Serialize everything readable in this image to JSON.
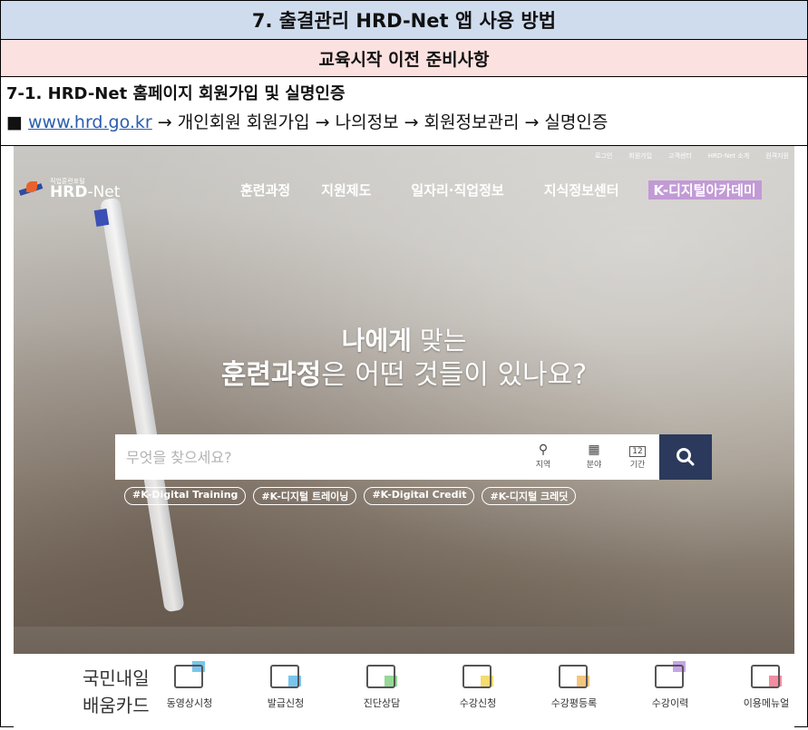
{
  "doc": {
    "title": "7. 출결관리 HRD-Net 앱 사용 방법",
    "section": "교육시작 이전 준비사항",
    "subsection": "7-1. HRD-Net 홈페이지 회원가입 및 실명인증",
    "path_bullet": "■",
    "path_link": "www.hrd.go.kr",
    "path_rest": " → 개인회원 회원가입 → 나의정보 → 회원정보관리 → 실명인증"
  },
  "site": {
    "top_links": [
      "로그인",
      "회원가입",
      "고객센터",
      "HRD-Net 소개",
      "원격지원"
    ],
    "logo_small": "직업훈련포털",
    "logo_big": "HRD",
    "logo_suffix": "-Net",
    "menu": [
      "훈련과정",
      "지원제도",
      "일자리·직업정보",
      "지식정보센터",
      "K-디지털아카데미"
    ],
    "headline_1_bold": "나에게",
    "headline_1_rest": " 맞는",
    "headline_2_bold": "훈련과정",
    "headline_2_rest": "은 어떤 것들이 있나요?",
    "search_placeholder": "무엇을 찾으세요?",
    "search_options": [
      {
        "icon": "⚲",
        "label": "지역"
      },
      {
        "icon": "▦",
        "label": "분야"
      },
      {
        "icon": "12",
        "label": "기간"
      }
    ],
    "search_button_icon": "search-icon",
    "tags": [
      "#K-Digital Training",
      "#K-디지털 트레이닝",
      "#K-Digital Credit",
      "#K-디지털 크레딧"
    ],
    "card_title_line1": "국민내일",
    "card_title_line2": "배움카드",
    "bottom_items": [
      {
        "label": "동영상시청",
        "color": "#58b7e8"
      },
      {
        "label": "발급신청",
        "color": "#58b7e8"
      },
      {
        "label": "진단상담",
        "color": "#7bd07a"
      },
      {
        "label": "수강신청",
        "color": "#f2d24c"
      },
      {
        "label": "수강평등록",
        "color": "#f2b760"
      },
      {
        "label": "수강이력",
        "color": "#b98de0"
      },
      {
        "label": "이용메뉴얼",
        "color": "#ef6f8a"
      }
    ]
  }
}
